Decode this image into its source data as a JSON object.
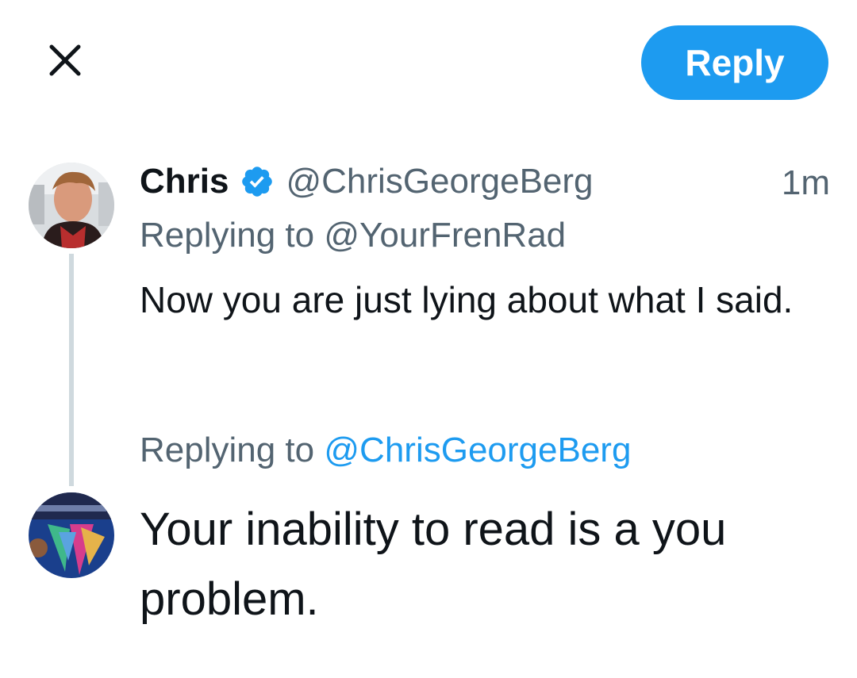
{
  "header": {
    "close_icon": "close-icon",
    "reply_button_label": "Reply"
  },
  "original_tweet": {
    "display_name": "Chris",
    "verified_icon": "verified-badge-icon",
    "handle": "@ChrisGeorgeBerg",
    "time": "1m",
    "replying_prefix": "Replying to",
    "replying_to": "@YourFrenRad",
    "text": "Now you are just lying about what I said."
  },
  "compose": {
    "replying_prefix": "Replying to",
    "replying_to": "@ChrisGeorgeBerg",
    "text": "Your inability to read is a you problem."
  },
  "colors": {
    "accent": "#1d9bf0",
    "secondary_text": "#536471",
    "primary_text": "#0f1419",
    "thread_line": "#cfd9de"
  }
}
